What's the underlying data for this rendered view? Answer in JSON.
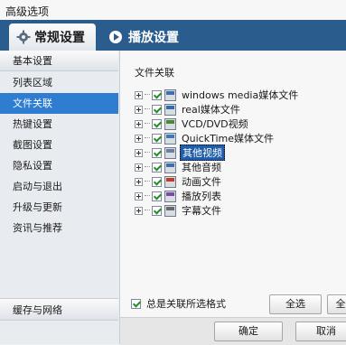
{
  "window": {
    "title": "高级选项"
  },
  "tabs": [
    {
      "label": "常规设置",
      "icon": "gear-icon",
      "active": true
    },
    {
      "label": "播放设置",
      "icon": "play-settings-icon",
      "active": false
    }
  ],
  "sidebar": {
    "items": [
      {
        "label": "基本设置",
        "kind": "header"
      },
      {
        "label": "列表区域"
      },
      {
        "label": "文件关联",
        "selected": true
      },
      {
        "label": "热键设置"
      },
      {
        "label": "截图设置"
      },
      {
        "label": "隐私设置"
      },
      {
        "label": "启动与退出"
      },
      {
        "label": "升级与更新"
      },
      {
        "label": "资讯与推荐"
      }
    ],
    "bottom": "缓存与网络"
  },
  "main": {
    "section_title": "文件关联",
    "tree": [
      {
        "label": "windows media媒体文件",
        "icon_color": "#3c6fb5",
        "checked": true
      },
      {
        "label": "real媒体文件",
        "icon_color": "#2e6db0",
        "checked": true
      },
      {
        "label": "VCD/DVD视频",
        "icon_color": "#4a8a2e",
        "checked": true
      },
      {
        "label": "QuickTime媒体文件",
        "icon_color": "#3b7ab8",
        "checked": true
      },
      {
        "label": "其他视频",
        "icon_color": "#6a7fa8",
        "checked": true,
        "selected": true
      },
      {
        "label": "其他音频",
        "icon_color": "#3a6fb0",
        "checked": true
      },
      {
        "label": "动画文件",
        "icon_color": "#c43a2a",
        "checked": true
      },
      {
        "label": "播放列表",
        "icon_color": "#7a4aa8",
        "checked": true
      },
      {
        "label": "字幕文件",
        "icon_color": "#6a6a6a",
        "checked": true
      }
    ],
    "always_assoc": {
      "label": "总是关联所选格式",
      "checked": true
    },
    "select_all": "全选",
    "clear_all": "全"
  },
  "footer": {
    "ok": "确定",
    "cancel": "取消"
  }
}
